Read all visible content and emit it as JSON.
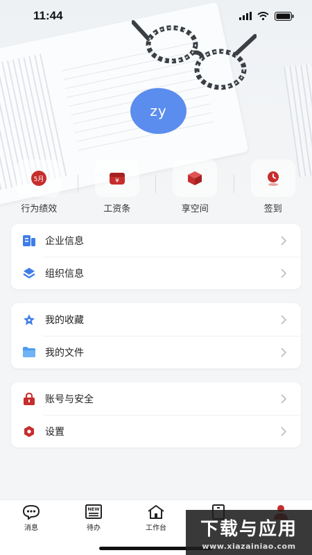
{
  "status_bar": {
    "time": "11:44"
  },
  "profile": {
    "avatar_text": "zy"
  },
  "quick_actions": [
    {
      "label": "行为绩效",
      "icon": "calendar-badge-icon",
      "badge": "5月"
    },
    {
      "label": "工资条",
      "icon": "wallet-icon",
      "badge": "¥"
    },
    {
      "label": "享空间",
      "icon": "cube-icon"
    },
    {
      "label": "签到",
      "icon": "location-clock-icon"
    }
  ],
  "menu_groups": [
    {
      "items": [
        {
          "label": "企业信息",
          "icon": "building-doc-icon"
        },
        {
          "label": "组织信息",
          "icon": "layers-icon"
        }
      ]
    },
    {
      "items": [
        {
          "label": "我的收藏",
          "icon": "star-icon"
        },
        {
          "label": "我的文件",
          "icon": "folder-icon"
        }
      ]
    },
    {
      "items": [
        {
          "label": "账号与安全",
          "icon": "lock-icon"
        },
        {
          "label": "设置",
          "icon": "settings-hex-icon"
        }
      ]
    }
  ],
  "tabbar": [
    {
      "label": "消息",
      "icon": "chat-bubble-icon"
    },
    {
      "label": "待办",
      "icon": "new-todo-icon",
      "badge": "NEW"
    },
    {
      "label": "工作台",
      "icon": "home-icon"
    },
    {
      "label": "",
      "icon": "contacts-icon"
    },
    {
      "label": "",
      "icon": "person-icon"
    }
  ],
  "watermark": {
    "title": "下载与应用",
    "url": "www.xiazainiao.com"
  },
  "colors": {
    "accent": "#5b8dee",
    "brand_red": "#c62d2d",
    "blue_icon": "#3f7de8"
  }
}
